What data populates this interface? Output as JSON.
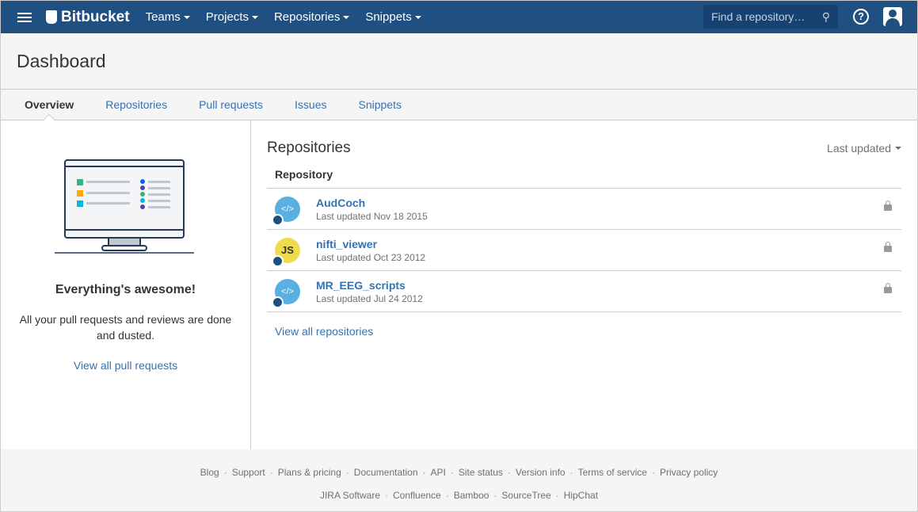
{
  "topbar": {
    "brand": "Bitbucket",
    "nav": [
      "Teams",
      "Projects",
      "Repositories",
      "Snippets"
    ],
    "search_placeholder": "Find a repository…",
    "help": "?"
  },
  "page_title": "Dashboard",
  "tabs": [
    "Overview",
    "Repositories",
    "Pull requests",
    "Issues",
    "Snippets"
  ],
  "left": {
    "heading": "Everything's awesome!",
    "text": "All your pull requests and reviews are done and dusted.",
    "link": "View all pull requests"
  },
  "repos": {
    "title": "Repositories",
    "sort": "Last updated",
    "column": "Repository",
    "view_all": "View all repositories",
    "items": [
      {
        "name": "AudCoch",
        "updated": "Last updated Nov 18 2015",
        "icon": "</>"
      },
      {
        "name": "nifti_viewer",
        "updated": "Last updated Oct 23 2012",
        "icon": "JS"
      },
      {
        "name": "MR_EEG_scripts",
        "updated": "Last updated Jul 24 2012",
        "icon": "</>"
      }
    ]
  },
  "footer": {
    "row1": [
      "Blog",
      "Support",
      "Plans & pricing",
      "Documentation",
      "API",
      "Site status",
      "Version info",
      "Terms of service",
      "Privacy policy"
    ],
    "row2": [
      "JIRA Software",
      "Confluence",
      "Bamboo",
      "SourceTree",
      "HipChat"
    ]
  }
}
